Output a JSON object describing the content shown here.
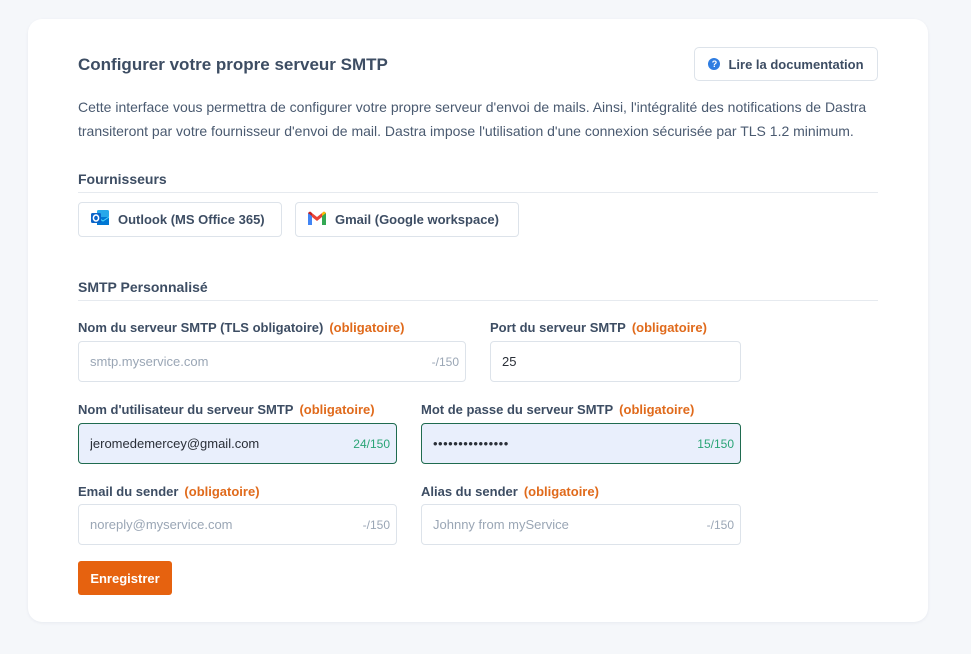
{
  "header": {
    "title": "Configurer votre propre serveur SMTP",
    "doc_button_label": "Lire la documentation"
  },
  "description": "Cette interface vous permettra de configurer votre propre serveur d'envoi de mails. Ainsi, l'intégralité des notifications de Dastra transiteront par votre fournisseur d'envoi de mail. Dastra impose l'utilisation d'une connexion sécurisée par TLS 1.2 minimum.",
  "providers": {
    "title": "Fournisseurs",
    "items": [
      {
        "label": "Outlook (MS Office 365)",
        "icon": "outlook-icon"
      },
      {
        "label": "Gmail (Google workspace)",
        "icon": "gmail-icon"
      }
    ]
  },
  "smtp": {
    "title": "SMTP Personnalisé",
    "required_label": "(obligatoire)",
    "server_name": {
      "label": "Nom du serveur SMTP (TLS obligatoire)",
      "value": "",
      "placeholder": "smtp.myservice.com",
      "counter": "-/150"
    },
    "port": {
      "label": "Port du serveur SMTP",
      "value": "25"
    },
    "username": {
      "label": "Nom d'utilisateur du serveur SMTP",
      "value": "jeromedemercey@gmail.com",
      "counter": "24/150"
    },
    "password": {
      "label": "Mot de passe du serveur SMTP",
      "value": "•••••••••••••••",
      "counter": "15/150"
    },
    "sender_email": {
      "label": "Email du sender",
      "value": "",
      "placeholder": "noreply@myservice.com",
      "counter": "-/150"
    },
    "sender_alias": {
      "label": "Alias du sender",
      "value": "",
      "placeholder": "Johnny from myService",
      "counter": "-/150"
    },
    "save_label": "Enregistrer"
  },
  "colors": {
    "accent": "#e6620f",
    "required": "#e06a1b",
    "focus_border": "#1f6b4f",
    "counter_ok": "#2aa476",
    "info": "#2f7de1"
  }
}
